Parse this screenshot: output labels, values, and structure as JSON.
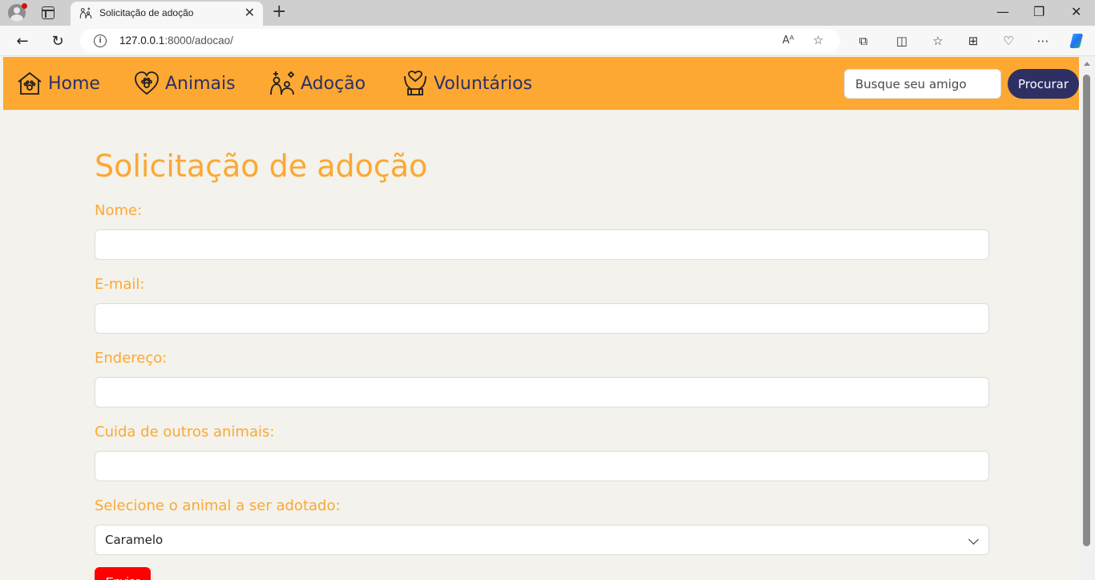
{
  "browser": {
    "tab_title": "Solicitação de adoção",
    "url_host": "127.0.0.1",
    "url_path": ":8000/adocao/"
  },
  "navbar": {
    "items": [
      {
        "label": "Home",
        "icon": "house-paw-icon"
      },
      {
        "label": "Animais",
        "icon": "heart-paw-icon"
      },
      {
        "label": "Adoção",
        "icon": "pets-icon"
      },
      {
        "label": "Voluntários",
        "icon": "hands-heart-icon"
      }
    ],
    "search_placeholder": "Busque seu amigo",
    "search_button": "Procurar",
    "background_color": "#fca833",
    "text_color": "#2e3064"
  },
  "form": {
    "title": "Solicitação de adoção",
    "fields": [
      {
        "label": "Nome:",
        "value": ""
      },
      {
        "label": "E-mail:",
        "value": ""
      },
      {
        "label": "Endereço:",
        "value": ""
      },
      {
        "label": "Cuida de outros animais:",
        "value": ""
      }
    ],
    "select_label": "Selecione o animal a ser adotado:",
    "select_value": "Caramelo",
    "submit_label": "Enviar",
    "accent_color": "#fca833",
    "submit_color": "#ff0000"
  }
}
